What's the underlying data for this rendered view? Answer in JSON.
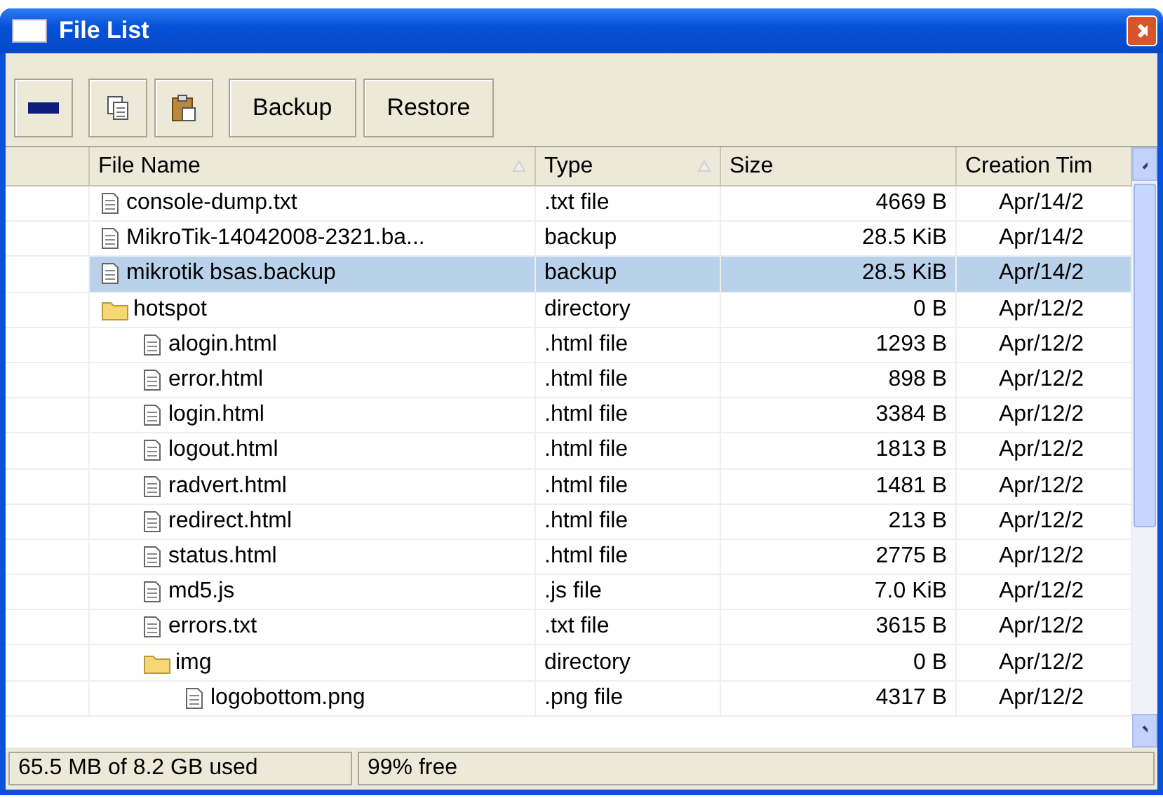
{
  "window": {
    "title": "File List"
  },
  "toolbar": {
    "buttons": [
      {
        "kind": "remove"
      },
      {
        "kind": "copy"
      },
      {
        "kind": "paste"
      },
      {
        "kind": "text",
        "label": "Backup"
      },
      {
        "kind": "text",
        "label": "Restore"
      }
    ]
  },
  "table": {
    "columns": [
      {
        "label": "File Name",
        "sort_indicator": true
      },
      {
        "label": "Type",
        "sort_indicator": true
      },
      {
        "label": "Size",
        "sort_indicator": false
      },
      {
        "label": "Creation Tim",
        "sort_indicator": false
      }
    ],
    "rows": [
      {
        "kind": "file",
        "name": "console-dump.txt",
        "type": ".txt file",
        "size": "4669 B",
        "created": "Apr/14/2",
        "selected": false
      },
      {
        "kind": "file",
        "name": "MikroTik-14042008-2321.ba...",
        "type": "backup",
        "size": "28.5 KiB",
        "created": "Apr/14/2",
        "selected": false
      },
      {
        "kind": "file",
        "name": "mikrotik bsas.backup",
        "type": "backup",
        "size": "28.5 KiB",
        "created": "Apr/14/2",
        "selected": true
      },
      {
        "kind": "folder",
        "name": "hotspot",
        "type": "directory",
        "size": "0 B",
        "created": "Apr/12/2",
        "selected": false,
        "children": [
          {
            "kind": "file",
            "name": "alogin.html",
            "type": ".html file",
            "size": "1293 B",
            "created": "Apr/12/2",
            "selected": false
          },
          {
            "kind": "file",
            "name": "error.html",
            "type": ".html file",
            "size": "898 B",
            "created": "Apr/12/2",
            "selected": false
          },
          {
            "kind": "file",
            "name": "login.html",
            "type": ".html file",
            "size": "3384 B",
            "created": "Apr/12/2",
            "selected": false
          },
          {
            "kind": "file",
            "name": "logout.html",
            "type": ".html file",
            "size": "1813 B",
            "created": "Apr/12/2",
            "selected": false
          },
          {
            "kind": "file",
            "name": "radvert.html",
            "type": ".html file",
            "size": "1481 B",
            "created": "Apr/12/2",
            "selected": false
          },
          {
            "kind": "file",
            "name": "redirect.html",
            "type": ".html file",
            "size": "213 B",
            "created": "Apr/12/2",
            "selected": false
          },
          {
            "kind": "file",
            "name": "status.html",
            "type": ".html file",
            "size": "2775 B",
            "created": "Apr/12/2",
            "selected": false
          },
          {
            "kind": "file",
            "name": "md5.js",
            "type": ".js file",
            "size": "7.0 KiB",
            "created": "Apr/12/2",
            "selected": false
          },
          {
            "kind": "file",
            "name": "errors.txt",
            "type": ".txt file",
            "size": "3615 B",
            "created": "Apr/12/2",
            "selected": false
          },
          {
            "kind": "folder",
            "name": "img",
            "type": "directory",
            "size": "0 B",
            "created": "Apr/12/2",
            "selected": false,
            "children": [
              {
                "kind": "file",
                "name": "logobottom.png",
                "type": ".png file",
                "size": "4317 B",
                "created": "Apr/12/2",
                "selected": false
              }
            ]
          }
        ]
      }
    ]
  },
  "status_bar": [
    "65.5 MB of 8.2 GB used",
    "99% free"
  ]
}
